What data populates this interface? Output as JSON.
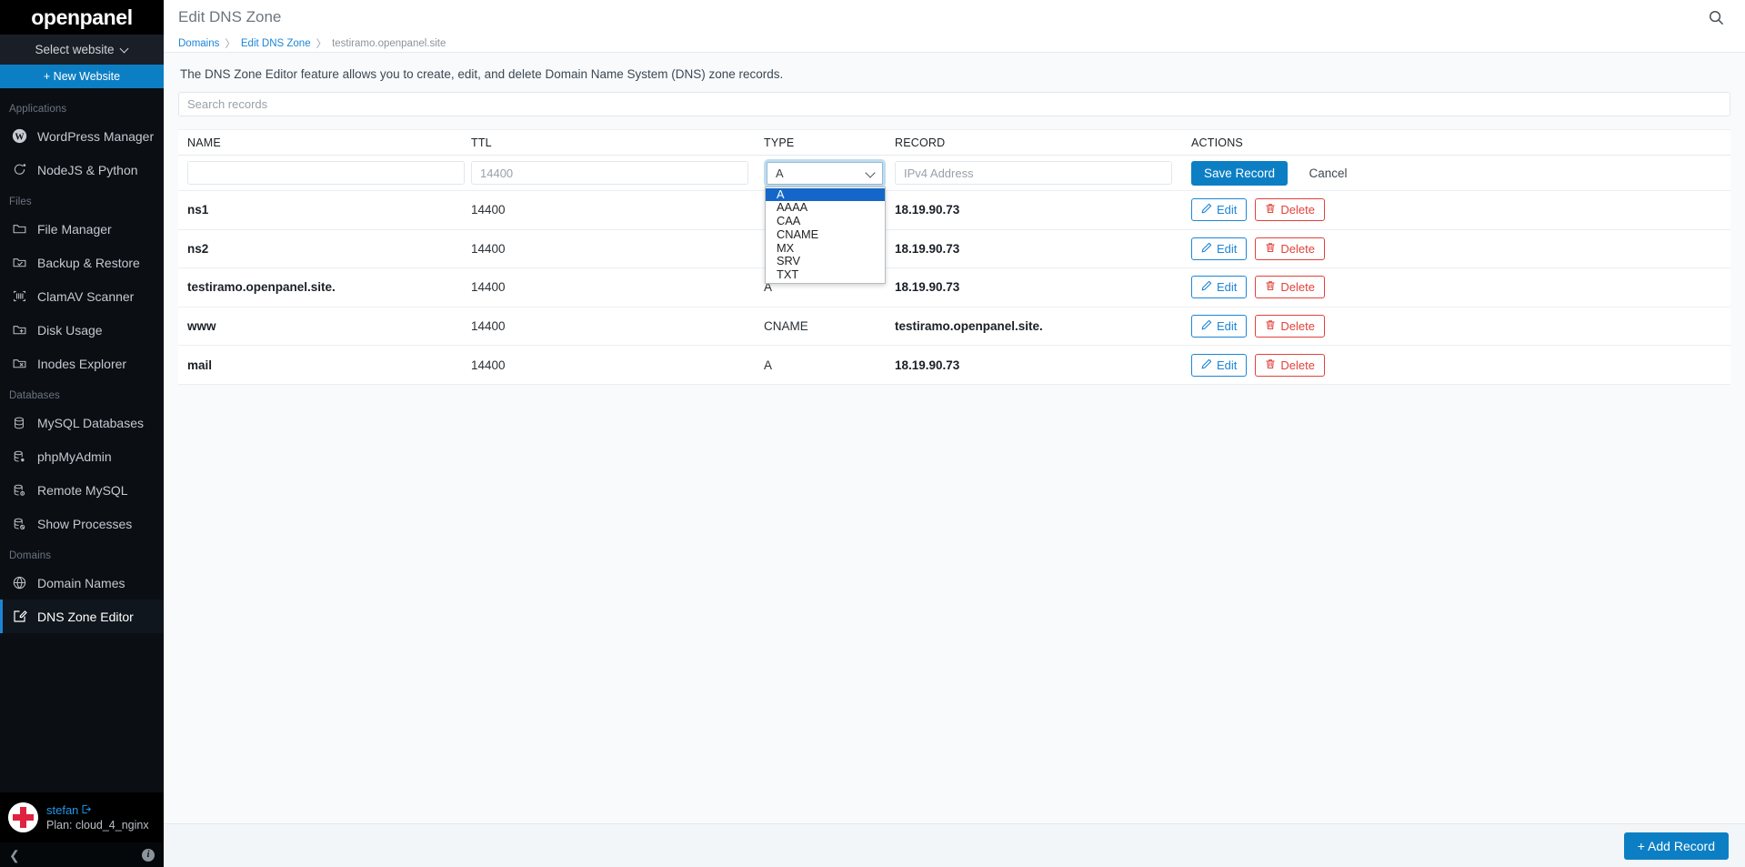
{
  "brand": {
    "name": "openpanel"
  },
  "sidebar": {
    "website_selector": {
      "label": "Select website",
      "icon": "chevron-down-icon"
    },
    "new_website_button": {
      "label": "+ New Website"
    },
    "sections": [
      {
        "title": "Applications",
        "items": [
          {
            "label": "WordPress Manager",
            "icon": "wordpress-icon",
            "active": false
          },
          {
            "label": "NodeJS & Python",
            "icon": "nodejs-icon",
            "active": false
          }
        ]
      },
      {
        "title": "Files",
        "items": [
          {
            "label": "File Manager",
            "icon": "folder-icon",
            "active": false
          },
          {
            "label": "Backup & Restore",
            "icon": "folder-check-icon",
            "active": false
          },
          {
            "label": "ClamAV Scanner",
            "icon": "scanner-icon",
            "active": false
          },
          {
            "label": "Disk Usage",
            "icon": "folder-plus-icon",
            "active": false
          },
          {
            "label": "Inodes Explorer",
            "icon": "folder-x-icon",
            "active": false
          }
        ]
      },
      {
        "title": "Databases",
        "items": [
          {
            "label": "MySQL Databases",
            "icon": "database-icon",
            "active": false
          },
          {
            "label": "phpMyAdmin",
            "icon": "database-gear-icon",
            "active": false
          },
          {
            "label": "Remote MySQL",
            "icon": "database-info-icon",
            "active": false
          },
          {
            "label": "Show Processes",
            "icon": "database-block-icon",
            "active": false
          }
        ]
      },
      {
        "title": "Domains",
        "items": [
          {
            "label": "Domain Names",
            "icon": "globe-icon",
            "active": false
          },
          {
            "label": "DNS Zone Editor",
            "icon": "edit-square-icon",
            "active": true
          }
        ]
      }
    ],
    "user": {
      "name": "stefan",
      "logout_icon": "logout-icon",
      "plan": "Plan: cloud_4_nginx",
      "avatar": "avatar"
    },
    "footer": {
      "collapse_icon": "chevron-left-icon",
      "info_icon": "info-icon"
    }
  },
  "header": {
    "title": "Edit DNS Zone",
    "search_icon": "search-icon",
    "breadcrumb": [
      {
        "label": "Domains",
        "link": true
      },
      {
        "label": "Edit DNS Zone",
        "link": true
      },
      {
        "label": "testiramo.openpanel.site",
        "link": false
      }
    ],
    "separator": "〉"
  },
  "main": {
    "intro": "The DNS Zone Editor feature allows you to create, edit, and delete Domain Name System (DNS) zone records.",
    "search": {
      "placeholder": "Search records",
      "value": ""
    },
    "table": {
      "columns": [
        "NAME",
        "TTL",
        "TYPE",
        "RECORD",
        "ACTIONS"
      ],
      "new_record_form": {
        "name": {
          "value": "",
          "placeholder": ""
        },
        "ttl": {
          "value": "14400",
          "placeholder": "14400"
        },
        "type": {
          "value": "A",
          "open": true,
          "chevron_icon": "chevron-down-icon",
          "options": [
            "A",
            "AAAA",
            "CAA",
            "CNAME",
            "MX",
            "SRV",
            "TXT"
          ],
          "selected_index": 0
        },
        "record": {
          "value": "",
          "placeholder": "IPv4 Address"
        },
        "save_label": "Save Record",
        "cancel_label": "Cancel"
      },
      "rows": [
        {
          "name": "ns1",
          "ttl": "14400",
          "type": "",
          "record": "18.19.90.73"
        },
        {
          "name": "ns2",
          "ttl": "14400",
          "type": "",
          "record": "18.19.90.73"
        },
        {
          "name": "testiramo.openpanel.site.",
          "ttl": "14400",
          "type": "A",
          "record": "18.19.90.73"
        },
        {
          "name": "www",
          "ttl": "14400",
          "type": "CNAME",
          "record": "testiramo.openpanel.site."
        },
        {
          "name": "mail",
          "ttl": "14400",
          "type": "A",
          "record": "18.19.90.73"
        }
      ],
      "row_actions": {
        "edit_label": "Edit",
        "edit_icon": "pencil-icon",
        "delete_label": "Delete",
        "delete_icon": "trash-icon"
      }
    },
    "footer": {
      "add_record_label": "+ Add Record"
    }
  },
  "colors": {
    "accent": "#0c7fc4",
    "link": "#1c86d6",
    "danger": "#e2423b",
    "sidebar_bg": "#0b0f14",
    "select_highlight": "#1467c8",
    "page_bg": "#f8fafc"
  }
}
